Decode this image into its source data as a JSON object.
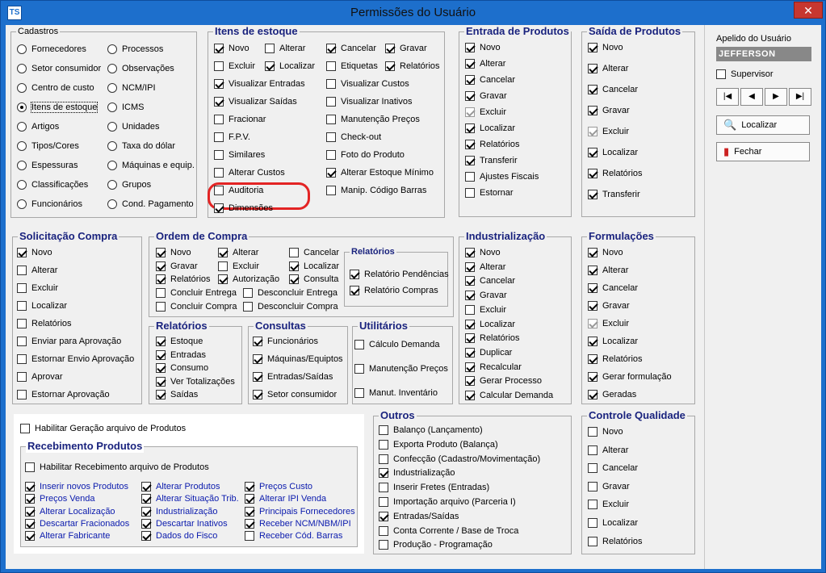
{
  "window": {
    "title": "Permissões do Usuário",
    "icon": "TS",
    "close": "✕"
  },
  "cadastros": {
    "title": "Cadastros",
    "col1": [
      {
        "label": "Fornecedores",
        "checked": false
      },
      {
        "label": "Setor consumidor",
        "checked": false
      },
      {
        "label": "Centro de custo",
        "checked": false
      },
      {
        "label": "Itens de estoque",
        "checked": true
      },
      {
        "label": "Artigos",
        "checked": false
      },
      {
        "label": "Tipos/Cores",
        "checked": false
      },
      {
        "label": "Espessuras",
        "checked": false
      },
      {
        "label": "Classificações",
        "checked": false
      },
      {
        "label": "Funcionários",
        "checked": false
      }
    ],
    "col2": [
      {
        "label": "Processos",
        "checked": false
      },
      {
        "label": "Observações",
        "checked": false
      },
      {
        "label": "NCM/IPI",
        "checked": false
      },
      {
        "label": "ICMS",
        "checked": false
      },
      {
        "label": "Unidades",
        "checked": false
      },
      {
        "label": "Taxa do dólar",
        "checked": false
      },
      {
        "label": "Máquinas e equip.",
        "checked": false
      },
      {
        "label": "Grupos",
        "checked": false
      },
      {
        "label": "Cond. Pagamento",
        "checked": false
      }
    ]
  },
  "itens": {
    "title": "Itens de estoque",
    "items": [
      {
        "label": "Novo",
        "checked": true
      },
      {
        "label": "Alterar",
        "checked": false
      },
      {
        "label": "Cancelar",
        "checked": true
      },
      {
        "label": "Gravar",
        "checked": true
      },
      {
        "label": "Excluir",
        "checked": false
      },
      {
        "label": "Localizar",
        "checked": true
      },
      {
        "label": "Etiquetas",
        "checked": false
      },
      {
        "label": "Relatórios",
        "checked": true
      },
      {
        "label": "Visualizar Entradas",
        "checked": true
      },
      {
        "label": "Visualizar Custos",
        "checked": false
      },
      {
        "label": "Visualizar Saídas",
        "checked": true
      },
      {
        "label": "Visualizar Inativos",
        "checked": false
      },
      {
        "label": "Fracionar",
        "checked": false
      },
      {
        "label": "Manutenção Preços",
        "checked": false
      },
      {
        "label": "F.P.V.",
        "checked": false
      },
      {
        "label": "Check-out",
        "checked": false
      },
      {
        "label": "Similares",
        "checked": false
      },
      {
        "label": "Foto do Produto",
        "checked": false
      },
      {
        "label": "Alterar Custos",
        "checked": false
      },
      {
        "label": "Alterar Estoque Mínimo",
        "checked": true
      },
      {
        "label": "Auditoria",
        "checked": false
      },
      {
        "label": "Manip. Código Barras",
        "checked": false
      },
      {
        "label": "Dimensões",
        "checked": true
      }
    ]
  },
  "entrada": {
    "title": "Entrada de Produtos",
    "items": [
      {
        "label": "Novo",
        "checked": true
      },
      {
        "label": "Alterar",
        "checked": true
      },
      {
        "label": "Cancelar",
        "checked": true
      },
      {
        "label": "Gravar",
        "checked": true
      },
      {
        "label": "Excluir",
        "checked": true,
        "dim": true
      },
      {
        "label": "Localizar",
        "checked": true
      },
      {
        "label": "Relatórios",
        "checked": true
      },
      {
        "label": "Transferir",
        "checked": true
      },
      {
        "label": "Ajustes Fiscais",
        "checked": false
      },
      {
        "label": "Estornar",
        "checked": false
      }
    ]
  },
  "saida": {
    "title": "Saída de Produtos",
    "items": [
      {
        "label": "Novo",
        "checked": true
      },
      {
        "label": "Alterar",
        "checked": true
      },
      {
        "label": "Cancelar",
        "checked": true
      },
      {
        "label": "Gravar",
        "checked": true
      },
      {
        "label": "Excluir",
        "checked": true,
        "dim": true
      },
      {
        "label": "Localizar",
        "checked": true
      },
      {
        "label": "Relatórios",
        "checked": true
      },
      {
        "label": "Transferir",
        "checked": true
      }
    ]
  },
  "solicitacao": {
    "title": "Solicitação Compra",
    "items": [
      {
        "label": "Novo",
        "checked": true
      },
      {
        "label": "Alterar",
        "checked": false
      },
      {
        "label": "Excluir",
        "checked": false
      },
      {
        "label": "Localizar",
        "checked": false
      },
      {
        "label": "Relatórios",
        "checked": false
      },
      {
        "label": "Enviar para Aprovação",
        "checked": false
      },
      {
        "label": "Estornar Envio Aprovação",
        "checked": false
      },
      {
        "label": "Aprovar",
        "checked": false
      },
      {
        "label": "Estornar Aprovação",
        "checked": false
      }
    ]
  },
  "ordem": {
    "title": "Ordem de Compra",
    "items": [
      {
        "label": "Novo",
        "checked": true
      },
      {
        "label": "Alterar",
        "checked": true
      },
      {
        "label": "Cancelar",
        "checked": false
      },
      {
        "label": "Gravar",
        "checked": true
      },
      {
        "label": "Excluir",
        "checked": false
      },
      {
        "label": "Localizar",
        "checked": true
      },
      {
        "label": "Relatórios",
        "checked": true
      },
      {
        "label": "Autorização",
        "checked": true
      },
      {
        "label": "Consulta",
        "checked": true
      },
      {
        "label": "Concluir Entrega",
        "checked": false
      },
      {
        "label": "Desconcluir Entrega",
        "checked": false
      },
      {
        "label": "Concluir Compra",
        "checked": false
      },
      {
        "label": "Desconcluir Compra",
        "checked": false
      }
    ],
    "relatorios": {
      "title": "Relatórios",
      "items": [
        {
          "label": "Relatório Pendências",
          "checked": true
        },
        {
          "label": "Relatório Compras",
          "checked": true
        }
      ]
    }
  },
  "relatorios": {
    "title": "Relatórios",
    "items": [
      {
        "label": "Estoque",
        "checked": true
      },
      {
        "label": "Entradas",
        "checked": true
      },
      {
        "label": "Consumo",
        "checked": true
      },
      {
        "label": "Ver Totalizações",
        "checked": true
      },
      {
        "label": "Saídas",
        "checked": true
      }
    ]
  },
  "consultas": {
    "title": "Consultas",
    "items": [
      {
        "label": "Funcionários",
        "checked": true
      },
      {
        "label": "Máquinas/Equiptos",
        "checked": true
      },
      {
        "label": "Entradas/Saídas",
        "checked": true
      },
      {
        "label": "Setor consumidor",
        "checked": true
      }
    ]
  },
  "utilitarios": {
    "title": "Utilitários",
    "items": [
      {
        "label": "Cálculo Demanda",
        "checked": false
      },
      {
        "label": "Manutenção Preços",
        "checked": false
      },
      {
        "label": "Manut. Inventário",
        "checked": false
      }
    ]
  },
  "industrializacao": {
    "title": "Industrialização",
    "items": [
      {
        "label": "Novo",
        "checked": true
      },
      {
        "label": "Alterar",
        "checked": true
      },
      {
        "label": "Cancelar",
        "checked": true
      },
      {
        "label": "Gravar",
        "checked": true
      },
      {
        "label": "Excluir",
        "checked": false
      },
      {
        "label": "Localizar",
        "checked": true
      },
      {
        "label": "Relatórios",
        "checked": true
      },
      {
        "label": "Duplicar",
        "checked": true
      },
      {
        "label": "Recalcular",
        "checked": true
      },
      {
        "label": "Gerar Processo",
        "checked": true
      },
      {
        "label": "Calcular Demanda",
        "checked": true
      }
    ]
  },
  "formulacoes": {
    "title": "Formulações",
    "items": [
      {
        "label": "Novo",
        "checked": true
      },
      {
        "label": "Alterar",
        "checked": true
      },
      {
        "label": "Cancelar",
        "checked": true
      },
      {
        "label": "Gravar",
        "checked": true
      },
      {
        "label": "Excluir",
        "checked": true,
        "dim": true
      },
      {
        "label": "Localizar",
        "checked": true
      },
      {
        "label": "Relatórios",
        "checked": true
      },
      {
        "label": "Gerar formulação",
        "checked": true
      },
      {
        "label": "Geradas",
        "checked": true
      }
    ]
  },
  "habilitar": {
    "label": "Habilitar Geração arquivo de Produtos",
    "checked": false
  },
  "recebimento": {
    "title": "Recebimento Produtos",
    "habilitar": {
      "label": "Habilitar Recebimento arquivo de Produtos",
      "checked": false
    },
    "items": [
      {
        "label": "Inserir novos Produtos",
        "checked": true
      },
      {
        "label": "Alterar Produtos",
        "checked": true
      },
      {
        "label": "Preços Custo",
        "checked": true
      },
      {
        "label": "Preços Venda",
        "checked": true
      },
      {
        "label": "Alterar Situação Trib.",
        "checked": true
      },
      {
        "label": "Alterar IPI Venda",
        "checked": true
      },
      {
        "label": "Alterar Localização",
        "checked": true
      },
      {
        "label": "Industrialização",
        "checked": true
      },
      {
        "label": "Principais Fornecedores",
        "checked": true
      },
      {
        "label": "Descartar Fracionados",
        "checked": true
      },
      {
        "label": "Descartar Inativos",
        "checked": true
      },
      {
        "label": "Receber NCM/NBM/IPI",
        "checked": true
      },
      {
        "label": "Alterar Fabricante",
        "checked": true
      },
      {
        "label": "Dados do Fisco",
        "checked": true
      },
      {
        "label": "Receber Cód. Barras",
        "checked": false
      }
    ]
  },
  "outros": {
    "title": "Outros",
    "items": [
      {
        "label": "Balanço (Lançamento)",
        "checked": false
      },
      {
        "label": "Exporta Produto (Balança)",
        "checked": false
      },
      {
        "label": "Confecção (Cadastro/Movimentação)",
        "checked": false
      },
      {
        "label": "Industrialização",
        "checked": true
      },
      {
        "label": "Inserir Fretes (Entradas)",
        "checked": false
      },
      {
        "label": "Importação arquivo (Parceria I)",
        "checked": false
      },
      {
        "label": "Entradas/Saídas",
        "checked": true
      },
      {
        "label": "Conta Corrente / Base de Troca",
        "checked": false
      },
      {
        "label": "Produção - Programação",
        "checked": false
      }
    ]
  },
  "controle": {
    "title": "Controle Qualidade",
    "items": [
      {
        "label": "Novo",
        "checked": false
      },
      {
        "label": "Alterar",
        "checked": false
      },
      {
        "label": "Cancelar",
        "checked": false
      },
      {
        "label": "Gravar",
        "checked": false
      },
      {
        "label": "Excluir",
        "checked": false
      },
      {
        "label": "Localizar",
        "checked": false
      },
      {
        "label": "Relatórios",
        "checked": false
      }
    ]
  },
  "side": {
    "apelido_label": "Apelido do Usuário",
    "apelido_value": "JEFFERSON",
    "supervisor": {
      "label": "Supervisor",
      "checked": false
    },
    "nav": [
      "|◀",
      "◀",
      "▶",
      "▶|"
    ],
    "localizar": "Localizar",
    "fechar": "Fechar"
  }
}
